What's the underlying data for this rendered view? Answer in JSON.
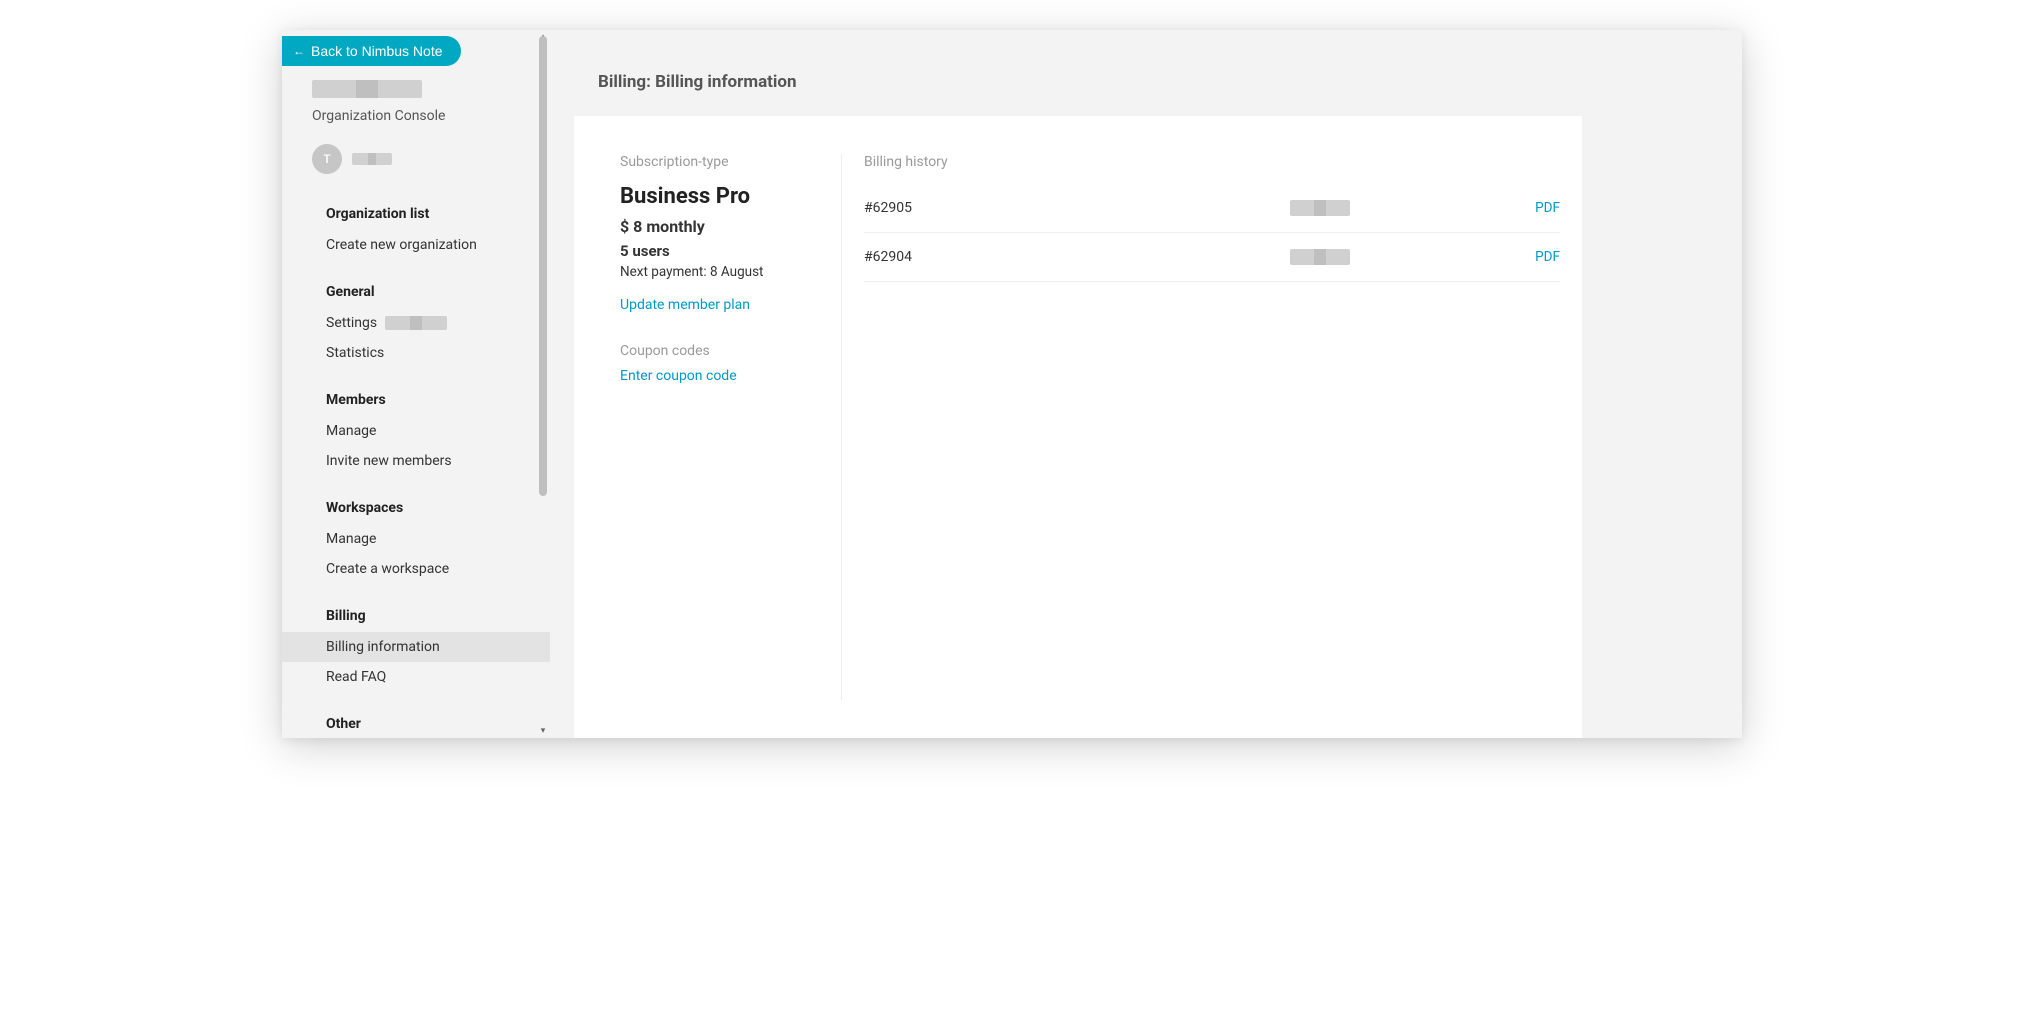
{
  "back_button": "Back to Nimbus Note",
  "org_subtitle": "Organization Console",
  "avatar_letter": "T",
  "nav": {
    "sec1_heading": "Organization list",
    "sec1_item1": "Create new organization",
    "sec2_heading": "General",
    "sec2_item1": "Settings",
    "sec2_item2": "Statistics",
    "sec3_heading": "Members",
    "sec3_item1": "Manage",
    "sec3_item2": "Invite new members",
    "sec4_heading": "Workspaces",
    "sec4_item1": "Manage",
    "sec4_item2": "Create a workspace",
    "sec5_heading": "Billing",
    "sec5_item1": "Billing information",
    "sec5_item2": "Read FAQ",
    "sec6_heading": "Other"
  },
  "page_title": "Billing: Billing information",
  "subscription": {
    "section_label": "Subscription-type",
    "plan_name": "Business Pro",
    "price": "$ 8 monthly",
    "users": "5 users",
    "next_payment": "Next payment: 8 August",
    "update_link": "Update member plan"
  },
  "coupon": {
    "label": "Coupon codes",
    "enter_link": "Enter coupon code"
  },
  "history": {
    "label": "Billing history",
    "row1_id": "#62905",
    "row2_id": "#62904",
    "pdf_label": "PDF"
  }
}
